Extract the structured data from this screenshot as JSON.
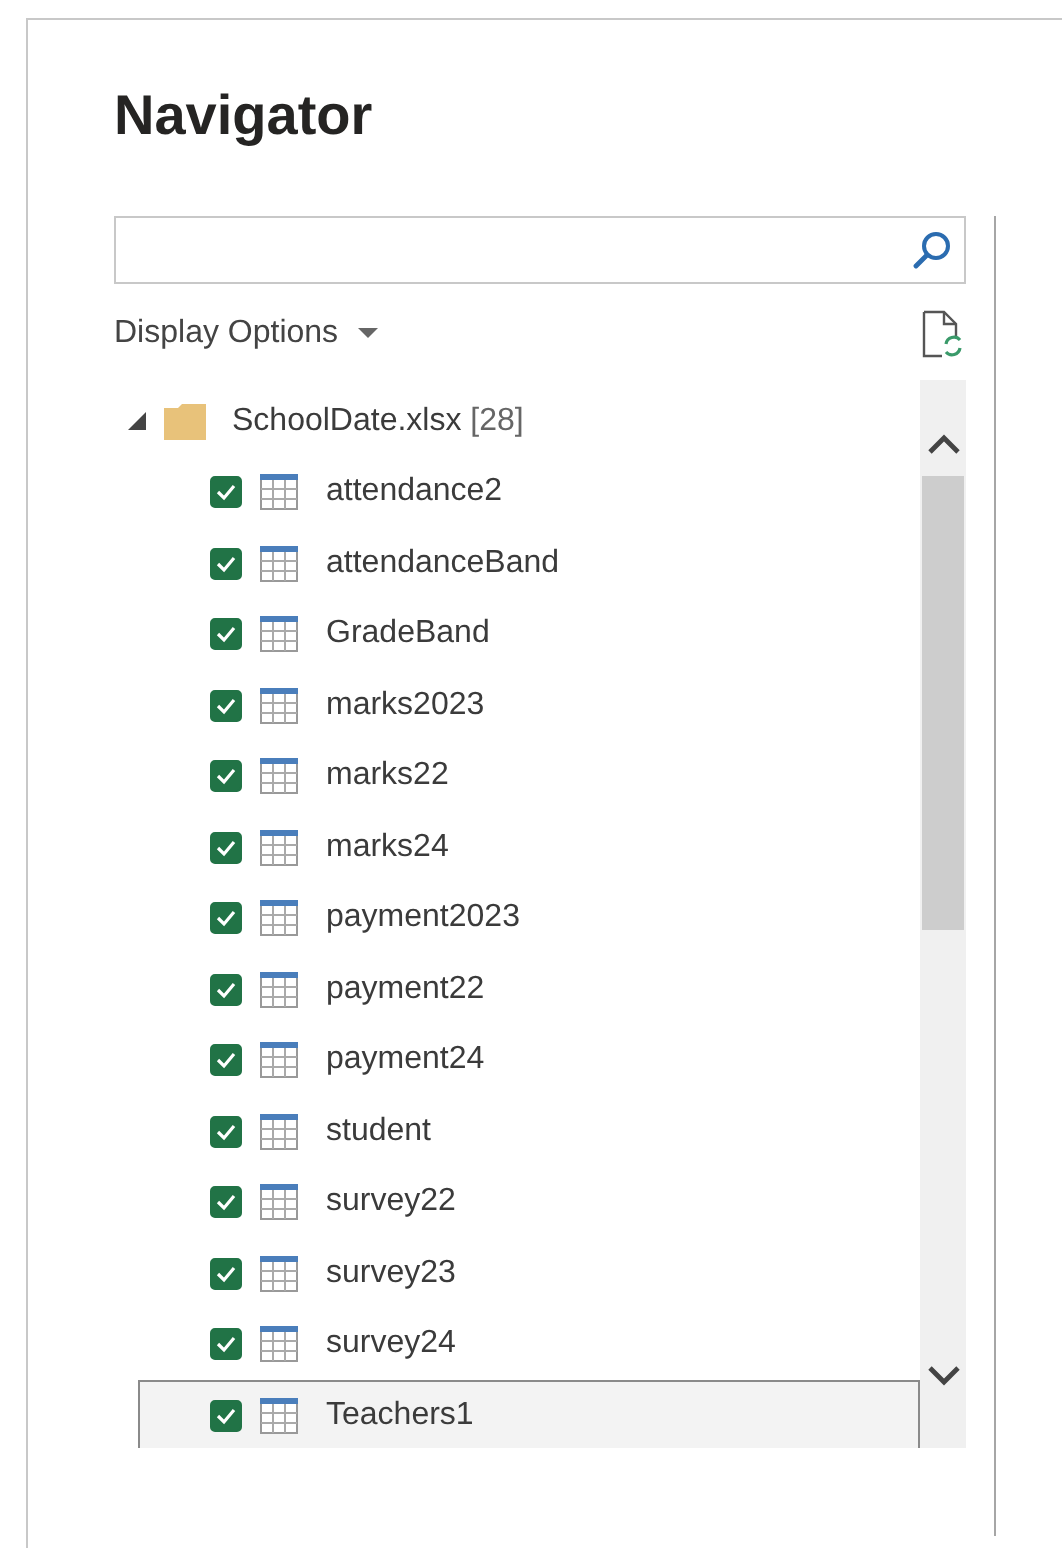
{
  "window": {
    "title": "Navigator"
  },
  "display_options": {
    "label": "Display Options"
  },
  "tree": {
    "label": "SchoolDate.xlsx",
    "count": "[28]",
    "expanded": true,
    "children": [
      {
        "label": "attendance2",
        "checked": true,
        "selected": false
      },
      {
        "label": "attendanceBand",
        "checked": true,
        "selected": false
      },
      {
        "label": "GradeBand",
        "checked": true,
        "selected": false
      },
      {
        "label": "marks2023",
        "checked": true,
        "selected": false
      },
      {
        "label": "marks22",
        "checked": true,
        "selected": false
      },
      {
        "label": "marks24",
        "checked": true,
        "selected": false
      },
      {
        "label": "payment2023",
        "checked": true,
        "selected": false
      },
      {
        "label": "payment22",
        "checked": true,
        "selected": false
      },
      {
        "label": "payment24",
        "checked": true,
        "selected": false
      },
      {
        "label": "student",
        "checked": true,
        "selected": false
      },
      {
        "label": "survey22",
        "checked": true,
        "selected": false
      },
      {
        "label": "survey23",
        "checked": true,
        "selected": false
      },
      {
        "label": "survey24",
        "checked": true,
        "selected": false
      },
      {
        "label": "Teachers1",
        "checked": true,
        "selected": true
      }
    ]
  }
}
